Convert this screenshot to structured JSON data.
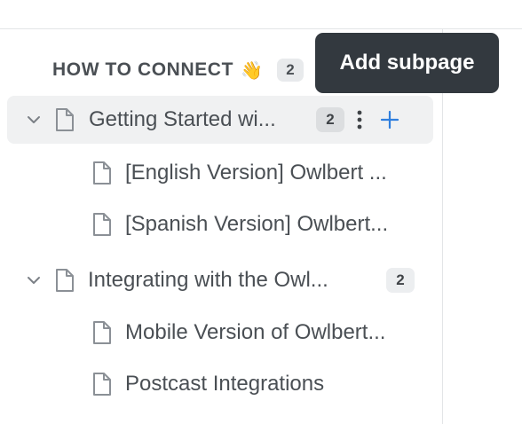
{
  "section": {
    "title": "HOW TO CONNECT",
    "emoji": "👋",
    "count": "2"
  },
  "tooltip": {
    "text": "Add subpage"
  },
  "tree": [
    {
      "label": "Getting Started wi...",
      "count": "2",
      "expanded": true,
      "active": true,
      "children": [
        {
          "label": "[English Version] Owlbert ..."
        },
        {
          "label": "[Spanish Version] Owlbert..."
        }
      ]
    },
    {
      "label": "Integrating with the Owl...",
      "count": "2",
      "expanded": true,
      "active": false,
      "children": [
        {
          "label": "Mobile Version of Owlbert..."
        },
        {
          "label": "Postcast Integrations"
        }
      ]
    }
  ],
  "icons": {
    "chevron": "chevron-down-icon",
    "page": "page-icon",
    "more": "more-vertical-icon",
    "add": "plus-icon"
  },
  "colors": {
    "accent": "#2f7fde",
    "tooltip_bg": "#33393f",
    "active_row": "#f0f1f2"
  }
}
